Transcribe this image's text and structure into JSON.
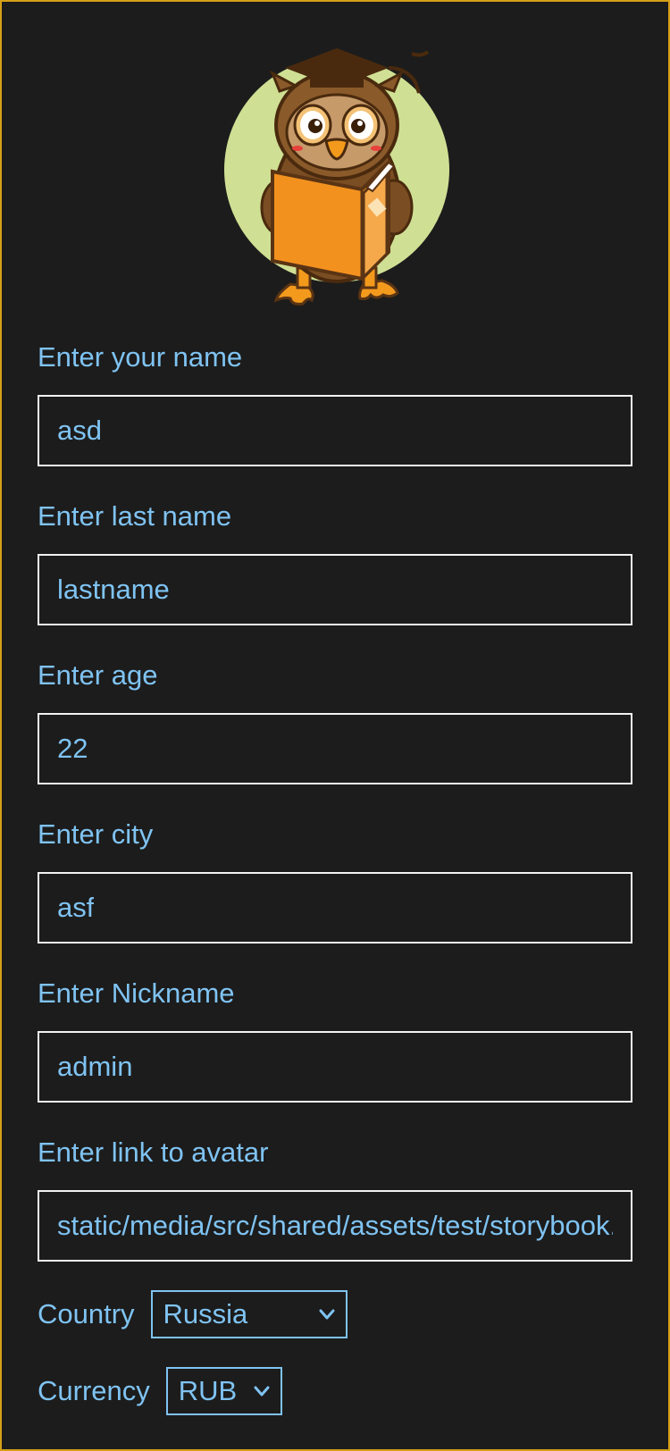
{
  "colors": {
    "background": "#1c1c1c",
    "frame_border": "#d4a017",
    "text_accent": "#7fc3f2",
    "input_border": "#f2f2f2",
    "select_border": "#7fc3f2"
  },
  "avatar": {
    "icon": "owl-reading-book-icon"
  },
  "form": {
    "name": {
      "label": "Enter your name",
      "value": "asd"
    },
    "lastname": {
      "label": "Enter last name",
      "value": "lastname"
    },
    "age": {
      "label": "Enter age",
      "value": "22"
    },
    "city": {
      "label": "Enter city",
      "value": "asf"
    },
    "nickname": {
      "label": "Enter Nickname",
      "value": "admin"
    },
    "avatar_link": {
      "label": "Enter link to avatar",
      "value": "static/media/src/shared/assets/test/storybook.jpg"
    },
    "country": {
      "label": "Country",
      "selected": "Russia"
    },
    "currency": {
      "label": "Currency",
      "selected": "RUB"
    }
  }
}
